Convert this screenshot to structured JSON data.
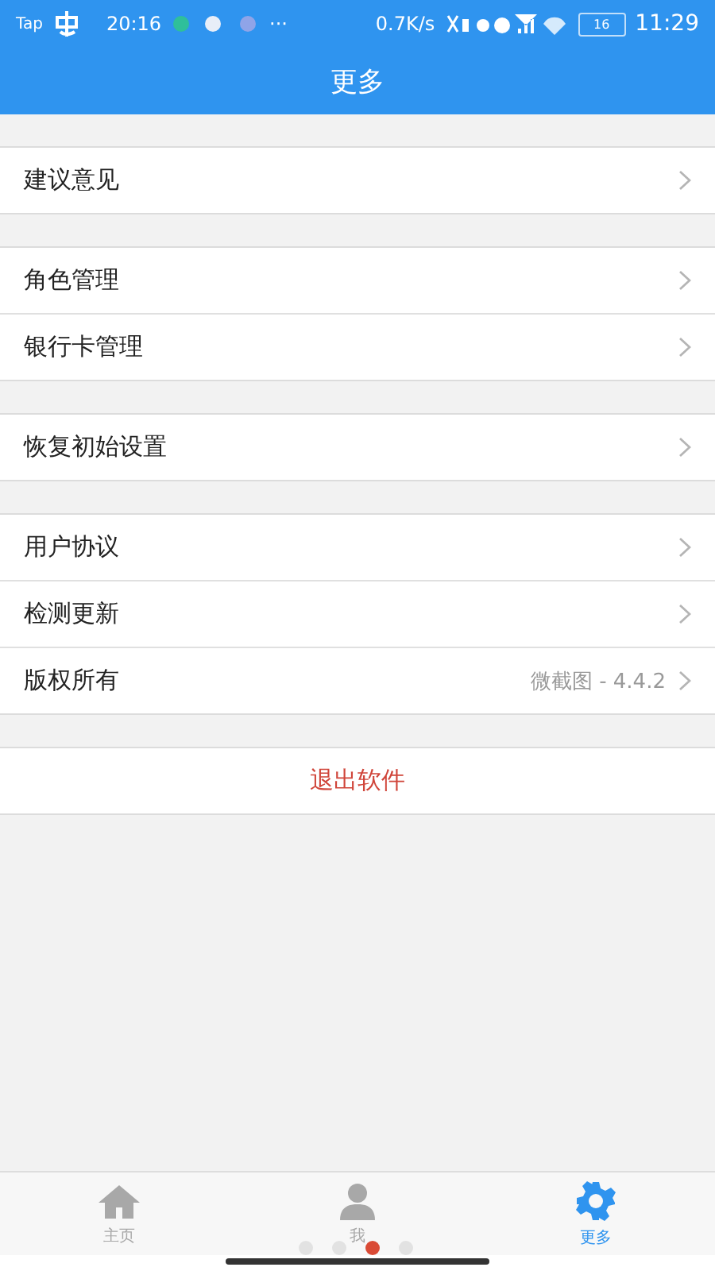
{
  "status_bar": {
    "carrier": "Tap",
    "clock": "20:16",
    "more": "···",
    "speed": "0.7K/s",
    "battery": "16",
    "time": "11:29"
  },
  "title": "更多",
  "groups": [
    [
      {
        "label": "建议意见"
      }
    ],
    [
      {
        "label": "角色管理"
      },
      {
        "label": "银行卡管理"
      }
    ],
    [
      {
        "label": "恢复初始设置"
      }
    ],
    [
      {
        "label": "用户协议"
      },
      {
        "label": "检测更新"
      },
      {
        "label": "版权所有",
        "value": "微截图 - 4.4.2"
      }
    ]
  ],
  "logout": "退出软件",
  "tabs": [
    {
      "label": "主页",
      "selected": false
    },
    {
      "label": "我",
      "selected": false
    },
    {
      "label": "更多",
      "selected": true
    }
  ],
  "page_dots": [
    {
      "selected": false
    },
    {
      "selected": false
    },
    {
      "selected": true
    },
    {
      "selected": false
    }
  ]
}
